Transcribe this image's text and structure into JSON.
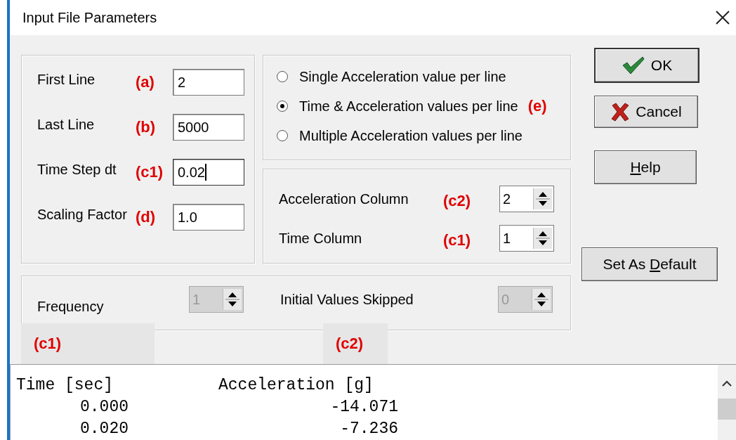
{
  "window": {
    "title": "Input File Parameters"
  },
  "fields": [
    {
      "label": "First Line",
      "annotation": "(a)",
      "value": "2",
      "focused": false
    },
    {
      "label": "Last Line",
      "annotation": "(b)",
      "value": "5000",
      "focused": false
    },
    {
      "label": "Time Step dt",
      "annotation": "(c1)",
      "value": "0.02",
      "focused": true
    },
    {
      "label": "Scaling Factor",
      "annotation": "(d)",
      "value": "1.0",
      "focused": false
    }
  ],
  "format_options": [
    {
      "label": "Single Acceleration value per line",
      "selected": false
    },
    {
      "label": "Time & Acceleration values per line",
      "selected": true,
      "annotation": "(e)"
    },
    {
      "label": "Multiple Acceleration values per line",
      "selected": false
    }
  ],
  "columns": [
    {
      "label": "Acceleration Column",
      "annotation": "(c2)",
      "value": "2"
    },
    {
      "label": "Time Column",
      "annotation": "(c1)",
      "value": "1"
    }
  ],
  "skip_settings": [
    {
      "label": "Frequency",
      "value": "1",
      "disabled": true
    },
    {
      "label": "Initial Values Skipped",
      "value": "0",
      "disabled": true
    }
  ],
  "buttons": [
    {
      "kind": "ok",
      "label_before": "OK"
    },
    {
      "kind": "cancel",
      "label_before": "Cancel"
    },
    {
      "kind": "plain",
      "access_key": "H",
      "label_after": "elp"
    },
    {
      "kind": "plain",
      "label_before": "Set As ",
      "access_key": "D",
      "label_after": "efault"
    }
  ],
  "column_tags": [
    "(c1)",
    "(c2)"
  ],
  "preview": {
    "header": [
      "Time [sec]",
      "Acceleration [g]"
    ],
    "rows": [
      [
        "0.000",
        "-14.071"
      ],
      [
        "0.020",
        "-7.236"
      ]
    ]
  }
}
